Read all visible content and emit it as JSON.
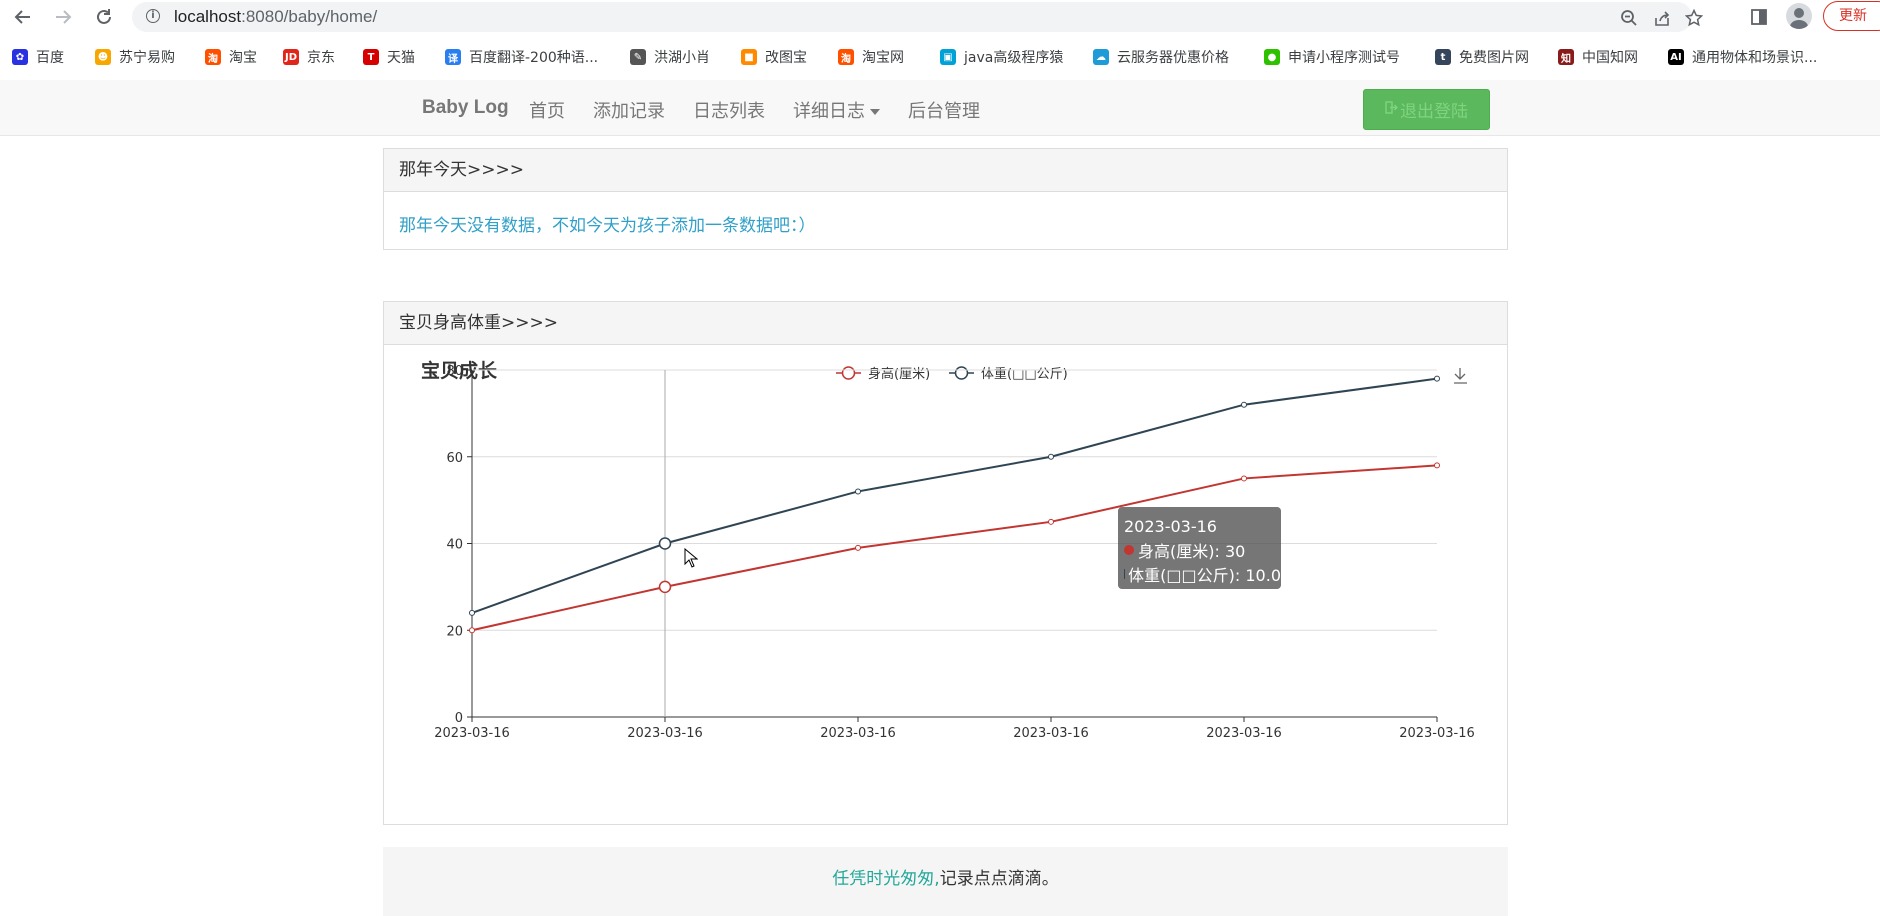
{
  "browser": {
    "url_host": "localhost",
    "url_rest": ":8080/baby/home/",
    "update_label": "更新"
  },
  "bookmarks": [
    {
      "label": "百度",
      "icon": "baidu-paw-icon",
      "color": "#2932e1"
    },
    {
      "label": "苏宁易购",
      "icon": "suning-lion-icon",
      "color": "#f7a700"
    },
    {
      "label": "淘宝",
      "icon": "taobao-icon",
      "color": "#ff5000"
    },
    {
      "label": "京东",
      "icon": "jd-icon",
      "color": "#e1251b"
    },
    {
      "label": "天猫",
      "icon": "tmall-icon",
      "color": "#d60000"
    },
    {
      "label": "百度翻译-200种语...",
      "icon": "baidu-translate-icon",
      "color": "#2a7ff0"
    },
    {
      "label": "洪湖小肖",
      "icon": "pen-icon",
      "color": "#555555"
    },
    {
      "label": "改图宝",
      "icon": "gaitubao-icon",
      "color": "#ff8a00"
    },
    {
      "label": "淘宝网",
      "icon": "taobao-icon",
      "color": "#ff5000"
    },
    {
      "label": "java高级程序猿",
      "icon": "bilibili-icon",
      "color": "#00a1d6"
    },
    {
      "label": "云服务器优惠价格",
      "icon": "cloud-icon",
      "color": "#1f9bd8"
    },
    {
      "label": "申请小程序测试号",
      "icon": "wechat-icon",
      "color": "#2dc100"
    },
    {
      "label": "免费图片网",
      "icon": "tumblr-icon",
      "color": "#35465c"
    },
    {
      "label": "中国知网",
      "icon": "cnki-icon",
      "color": "#8a1b1b"
    },
    {
      "label": "通用物体和场景识...",
      "icon": "ai-icon",
      "color": "#000000"
    }
  ],
  "navbar": {
    "brand": "Baby Log",
    "links": [
      "首页",
      "添加记录",
      "日志列表",
      "详细日志",
      "后台管理"
    ],
    "logout": "退出登陆"
  },
  "panel_today": {
    "heading": "那年今天>>>>",
    "message": "那年今天没有数据，不如今天为孩子添加一条数据吧：）"
  },
  "panel_growth": {
    "heading": "宝贝身高体重>>>>"
  },
  "chart_data": {
    "type": "line",
    "title": "宝贝成长",
    "categories": [
      "2023-03-16",
      "2023-03-16",
      "2023-03-16",
      "2023-03-16",
      "2023-03-16",
      "2023-03-16"
    ],
    "series": [
      {
        "name": "身高(厘米)",
        "color": "#c23531",
        "values": [
          20,
          30,
          39,
          45,
          55,
          58
        ]
      },
      {
        "name": "体重(□□公斤)",
        "color": "#2f4554",
        "values": [
          24,
          40,
          52,
          60,
          72,
          78
        ]
      }
    ],
    "ylim": [
      0,
      80
    ],
    "yticks": [
      0,
      20,
      40,
      60,
      80
    ],
    "grid": true,
    "legend": "top-center",
    "tooltip": {
      "title": "2023-03-16",
      "rows": [
        "身高(厘米): 30",
        "体重(□□公斤): 10.0"
      ]
    }
  },
  "footer": {
    "part1": "任凭时光匆匆,",
    "part2": "记录点点滴滴。"
  }
}
